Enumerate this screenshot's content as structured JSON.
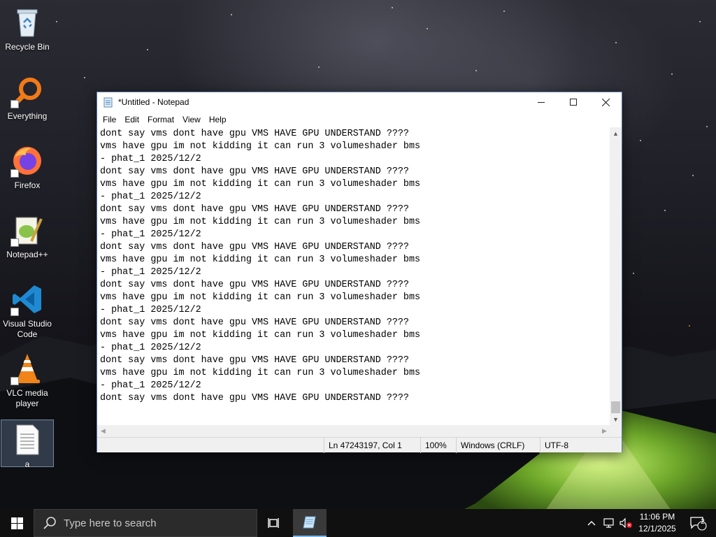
{
  "desktop": {
    "icons": [
      {
        "label": "Recycle Bin"
      },
      {
        "label": "Everything"
      },
      {
        "label": "Firefox"
      },
      {
        "label": "Notepad++"
      },
      {
        "label": "Visual Studio Code"
      },
      {
        "label": "VLC media player"
      },
      {
        "label": "a"
      }
    ]
  },
  "notepad": {
    "title": "*Untitled - Notepad",
    "menu": [
      "File",
      "Edit",
      "Format",
      "View",
      "Help"
    ],
    "lines": [
      "dont say vms dont have gpu VMS HAVE GPU UNDERSTAND ????",
      "vms have gpu im not kidding it can run 3 volumeshader bms",
      "- phat_1 2025/12/2",
      "dont say vms dont have gpu VMS HAVE GPU UNDERSTAND ????",
      "vms have gpu im not kidding it can run 3 volumeshader bms",
      "- phat_1 2025/12/2",
      "dont say vms dont have gpu VMS HAVE GPU UNDERSTAND ????",
      "vms have gpu im not kidding it can run 3 volumeshader bms",
      "- phat_1 2025/12/2",
      "dont say vms dont have gpu VMS HAVE GPU UNDERSTAND ????",
      "vms have gpu im not kidding it can run 3 volumeshader bms",
      "- phat_1 2025/12/2",
      "dont say vms dont have gpu VMS HAVE GPU UNDERSTAND ????",
      "vms have gpu im not kidding it can run 3 volumeshader bms",
      "- phat_1 2025/12/2",
      "dont say vms dont have gpu VMS HAVE GPU UNDERSTAND ????",
      "vms have gpu im not kidding it can run 3 volumeshader bms",
      "- phat_1 2025/12/2",
      "dont say vms dont have gpu VMS HAVE GPU UNDERSTAND ????",
      "vms have gpu im not kidding it can run 3 volumeshader bms",
      "- phat_1 2025/12/2",
      "dont say vms dont have gpu VMS HAVE GPU UNDERSTAND ????"
    ],
    "status": {
      "position": "Ln 47243197, Col 1",
      "zoom": "100%",
      "line_ending": "Windows (CRLF)",
      "encoding": "UTF-8"
    }
  },
  "taskbar": {
    "search_placeholder": "Type here to search",
    "time": "11:06 PM",
    "date": "12/1/2025",
    "notification_count": "2"
  },
  "colors": {
    "taskbar": "#101010",
    "accent": "#76b9ed",
    "window_border": "#5a7aa8"
  }
}
